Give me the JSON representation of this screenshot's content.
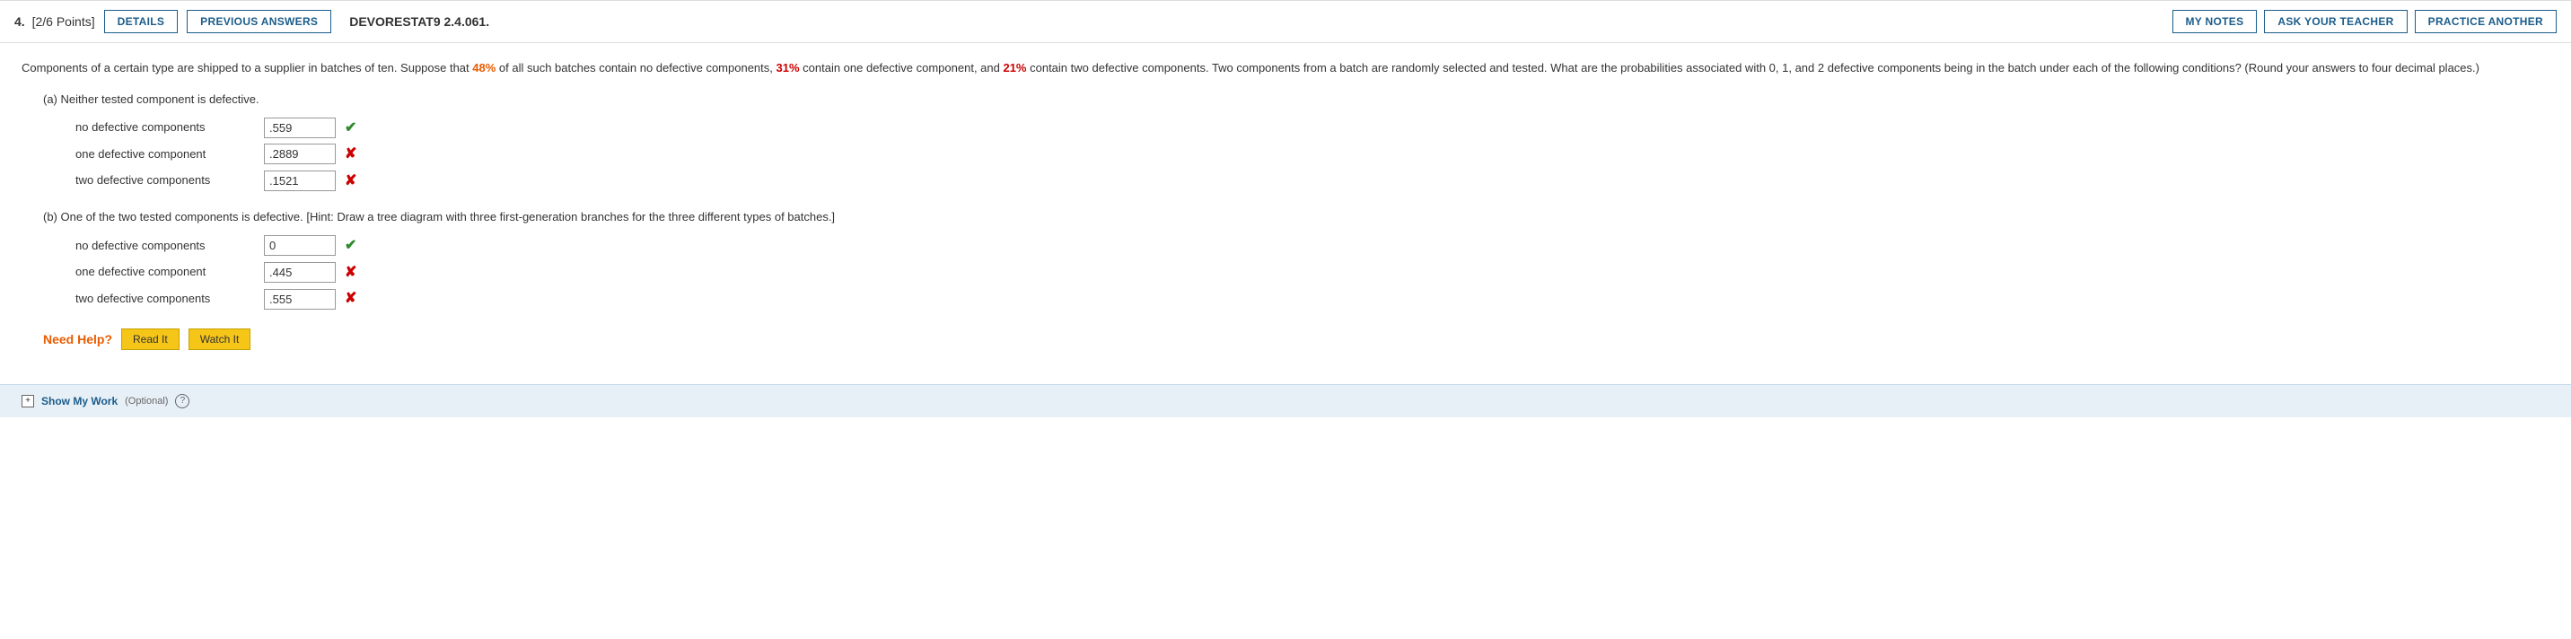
{
  "header": {
    "question_number": "4.",
    "points": "[2/6 Points]",
    "details_label": "DETAILS",
    "previous_answers_label": "PREVIOUS ANSWERS",
    "title": "DEVORESTAT9 2.4.061.",
    "my_notes_label": "MY NOTES",
    "ask_teacher_label": "ASK YOUR TEACHER",
    "practice_another_label": "PRACTICE ANOTHER"
  },
  "problem": {
    "text_before": "Components of a certain type are shipped to a supplier in batches of ten. Suppose that ",
    "pct1": "48%",
    "text2": " of all such batches contain no defective components, ",
    "pct2": "31%",
    "text3": " contain one defective component, and ",
    "pct3": "21%",
    "text4": " contain two defective components. Two components from a batch are randomly selected and tested. What are the probabilities associated with 0, 1, and 2 defective components being in the batch under each of the following conditions? (Round your answers to four decimal places.)"
  },
  "part_a": {
    "label": "(a) Neither tested component is defective.",
    "rows": [
      {
        "label": "no defective components",
        "value": ".559",
        "status": "correct"
      },
      {
        "label": "one defective component",
        "value": ".2889",
        "status": "incorrect"
      },
      {
        "label": "two defective components",
        "value": ".1521",
        "status": "incorrect"
      }
    ]
  },
  "part_b": {
    "label": "(b) One of the two tested components is defective. [Hint: Draw a tree diagram with three first-generation branches for the three different types of batches.]",
    "rows": [
      {
        "label": "no defective components",
        "value": "0",
        "status": "correct"
      },
      {
        "label": "one defective component",
        "value": ".445",
        "status": "incorrect"
      },
      {
        "label": "two defective components",
        "value": ".555",
        "status": "incorrect"
      }
    ]
  },
  "need_help": {
    "label": "Need Help?",
    "read_it": "Read It",
    "watch_it": "Watch It"
  },
  "show_my_work": {
    "label": "Show My Work",
    "optional": "(Optional)",
    "help_icon": "?"
  }
}
